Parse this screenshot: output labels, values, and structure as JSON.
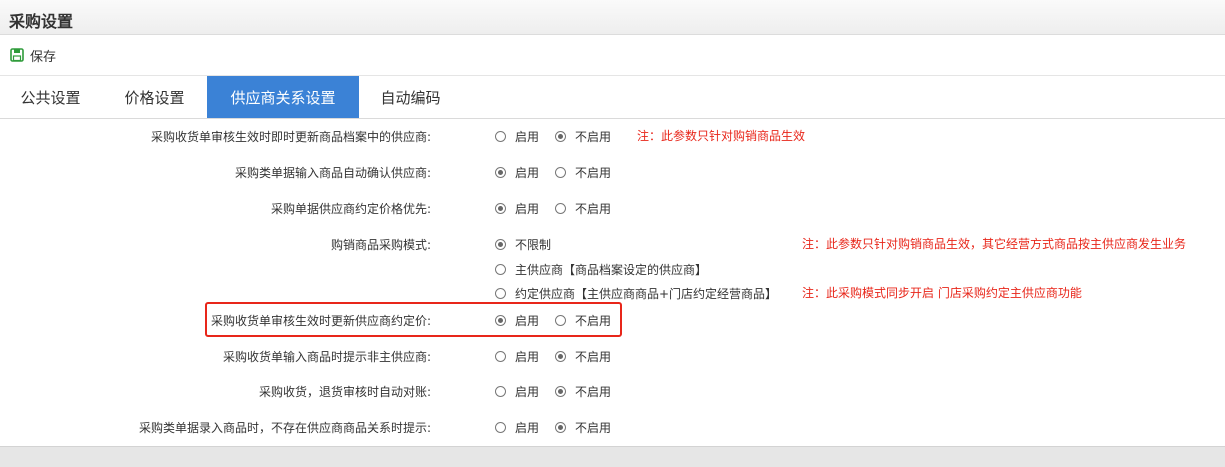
{
  "page": {
    "title": "采购设置"
  },
  "toolbar": {
    "save_label": "保存",
    "save_icon": "save-disk-icon"
  },
  "tabs": [
    {
      "label": "公共设置",
      "active": false
    },
    {
      "label": "价格设置",
      "active": false
    },
    {
      "label": "供应商关系设置",
      "active": true
    },
    {
      "label": "自动编码",
      "active": false
    }
  ],
  "settings": {
    "s1": {
      "label": "采购收货单审核生效时即时更新商品档案中的供应商:",
      "opt1": "启用",
      "opt2": "不启用",
      "selected": "不启用",
      "note": "注：此参数只针对购销商品生效"
    },
    "s2": {
      "label": "采购类单据输入商品自动确认供应商:",
      "opt1": "启用",
      "opt2": "不启用",
      "selected": "启用"
    },
    "s3": {
      "label": "采购单据供应商约定价格优先:",
      "opt1": "启用",
      "opt2": "不启用",
      "selected": "启用"
    },
    "s4": {
      "label": "购销商品采购模式:",
      "opt1": "不限制",
      "opt2": "主供应商【商品档案设定的供应商】",
      "opt3": "约定供应商【主供应商商品+门店约定经营商品】",
      "selected": "不限制",
      "note1": "注：此参数只针对购销商品生效，其它经营方式商品按主供应商发生业务",
      "note2": "注：此采购模式同步开启 门店采购约定主供应商功能"
    },
    "s5": {
      "label": "采购收货单审核生效时更新供应商约定价:",
      "opt1": "启用",
      "opt2": "不启用",
      "selected": "启用"
    },
    "s6": {
      "label": "采购收货单输入商品时提示非主供应商:",
      "opt1": "启用",
      "opt2": "不启用",
      "selected": "不启用"
    },
    "s7": {
      "label": "采购收货，退货审核时自动对账:",
      "opt1": "启用",
      "opt2": "不启用",
      "selected": "不启用"
    },
    "s8": {
      "label": "采购类单据录入商品时，不存在供应商商品关系时提示:",
      "opt1": "启用",
      "opt2": "不启用",
      "selected": "不启用"
    }
  },
  "colors": {
    "accent": "#3b82d6",
    "note": "#e8261a",
    "highlight": "#e8261a"
  }
}
